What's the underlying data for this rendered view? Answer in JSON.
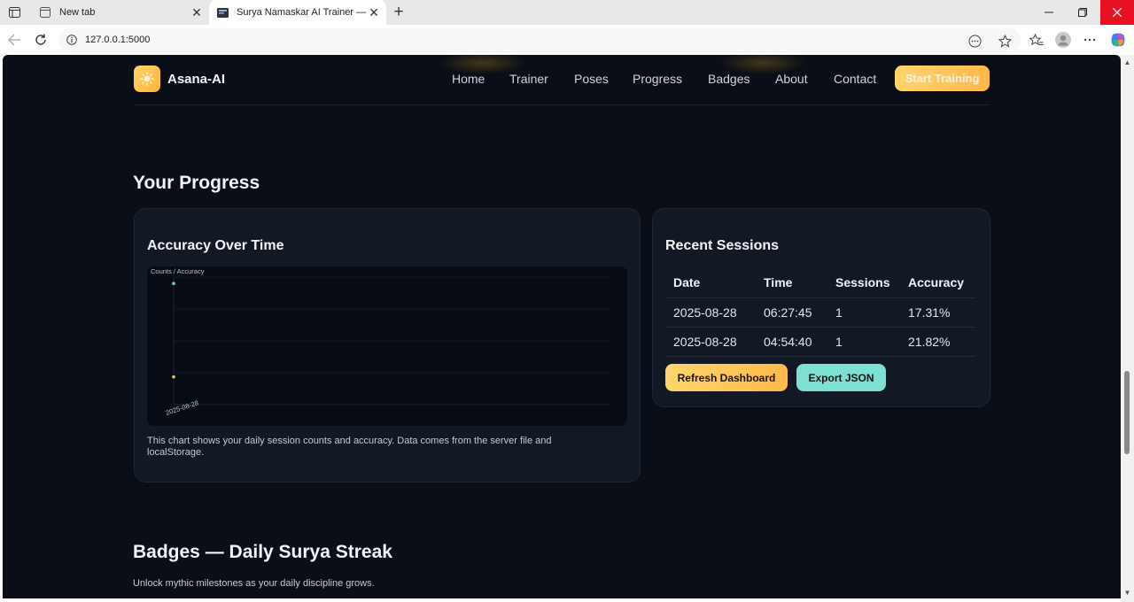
{
  "browser": {
    "tabs": [
      {
        "title": "New tab",
        "active": false
      },
      {
        "title": "Surya Namaskar AI Trainer — Hor",
        "active": true
      }
    ],
    "url": "127.0.0.1:5000"
  },
  "header": {
    "brand": "Asana-AI",
    "nav": [
      "Home",
      "Trainer",
      "Poses",
      "Progress",
      "Badges",
      "About",
      "Contact"
    ],
    "cta": "Start Training"
  },
  "progress": {
    "title": "Your Progress",
    "chart_card": {
      "title": "Accuracy Over Time",
      "caption": "This chart shows your daily session counts and accuracy. Data comes from the server file and localStorage."
    },
    "sessions_card": {
      "title": "Recent Sessions",
      "columns": [
        "Date",
        "Time",
        "Sessions",
        "Accuracy"
      ],
      "rows": [
        [
          "2025-08-28",
          "06:27:45",
          "1",
          "17.31%"
        ],
        [
          "2025-08-28",
          "04:54:40",
          "1",
          "21.82%"
        ]
      ],
      "refresh_label": "Refresh Dashboard",
      "export_label": "Export JSON"
    }
  },
  "badges": {
    "title": "Badges — Daily Surya Streak",
    "subtitle": "Unlock mythic milestones as your daily discipline grows."
  },
  "chart_data": {
    "type": "line",
    "ylabel": "Counts / Accuracy",
    "x": [
      "2025-08-28"
    ],
    "series": [
      {
        "values": [
          1
        ],
        "color": "#f2c14e"
      },
      {
        "values": [
          21.82
        ],
        "color": "#5fd3c3"
      }
    ],
    "grid": true
  },
  "colors": {
    "accent": "#ffbf4f",
    "teal": "#7ee0d2",
    "page_bg": "#0a0e16",
    "card_bg": "#121824"
  }
}
